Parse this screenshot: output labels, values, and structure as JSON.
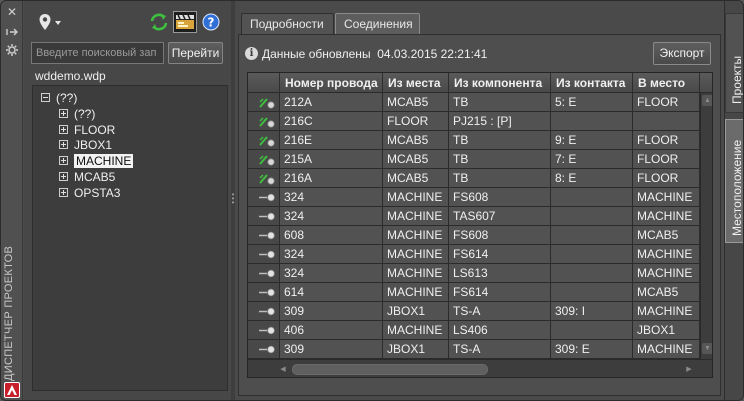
{
  "strip": {
    "title": "ДИСПЕТЧЕР ПРОЕКТОВ",
    "icons": [
      "close-icon",
      "pin-icon",
      "settings-icon"
    ],
    "logo": "autocad-electrical-logo"
  },
  "toolbar": {
    "icons": [
      "location-pin-icon",
      "dropdown-arrow-icon",
      "refresh-icon",
      "clapperboard-icon",
      "help-icon"
    ]
  },
  "search": {
    "placeholder": "Введите поисковый зап",
    "go_label": "Перейти"
  },
  "project": {
    "name": "wddemo.wdp"
  },
  "tree": {
    "root": "(??)",
    "children": [
      {
        "label": "(??)",
        "expanded": false
      },
      {
        "label": "FLOOR",
        "expanded": false
      },
      {
        "label": "JBOX1",
        "expanded": false
      },
      {
        "label": "MACHINE",
        "expanded": false,
        "selected": true
      },
      {
        "label": "MCAB5",
        "expanded": false
      },
      {
        "label": "OPSTA3",
        "expanded": false
      }
    ]
  },
  "tabs": [
    {
      "label": "Подробности",
      "active": false
    },
    {
      "label": "Соединения",
      "active": true
    }
  ],
  "info": {
    "text": "Данные обновлены",
    "datetime": "04.03.2015 22:21:41"
  },
  "export_label": "Экспорт",
  "grid": {
    "columns": [
      "",
      "Номер провода",
      "Из места",
      "Из компонента",
      "Из контакта",
      "В место"
    ],
    "rows": [
      {
        "type": "wire",
        "cells": [
          "212A",
          "MCAB5",
          "TB",
          "5: E",
          "FLOOR"
        ]
      },
      {
        "type": "wire",
        "cells": [
          "216C",
          "FLOOR",
          "PJ215 : [P]",
          "",
          ""
        ]
      },
      {
        "type": "wire",
        "cells": [
          "216E",
          "MCAB5",
          "TB",
          "9: E",
          "FLOOR"
        ]
      },
      {
        "type": "wire",
        "cells": [
          "215A",
          "MCAB5",
          "TB",
          "7: E",
          "FLOOR"
        ]
      },
      {
        "type": "wire",
        "cells": [
          "216A",
          "MCAB5",
          "TB",
          "8: E",
          "FLOOR"
        ]
      },
      {
        "type": "cable",
        "cells": [
          "324",
          "MACHINE",
          "FS608",
          "",
          "MACHINE"
        ]
      },
      {
        "type": "cable",
        "cells": [
          "324",
          "MACHINE",
          "TAS607",
          "",
          "MACHINE"
        ]
      },
      {
        "type": "cable",
        "cells": [
          "608",
          "MACHINE",
          "FS608",
          "",
          "MCAB5"
        ]
      },
      {
        "type": "cable",
        "cells": [
          "324",
          "MACHINE",
          "FS614",
          "",
          "MACHINE"
        ]
      },
      {
        "type": "cable",
        "cells": [
          "324",
          "MACHINE",
          "LS613",
          "",
          "MACHINE"
        ]
      },
      {
        "type": "cable",
        "cells": [
          "614",
          "MACHINE",
          "FS614",
          "",
          "MCAB5"
        ]
      },
      {
        "type": "cable",
        "cells": [
          "309",
          "JBOX1",
          "TS-A",
          "309: I",
          "MACHINE"
        ]
      },
      {
        "type": "cable",
        "cells": [
          "406",
          "MACHINE",
          "LS406",
          "",
          "JBOX1"
        ]
      },
      {
        "type": "cable",
        "cells": [
          "309",
          "JBOX1",
          "TS-A",
          "309: E",
          "MACHINE"
        ]
      }
    ]
  },
  "side_tabs": [
    {
      "label": "Проекты",
      "active": false
    },
    {
      "label": "Местоположение",
      "active": true
    }
  ],
  "colors": {
    "accent_green": "#3fbf3f",
    "logo_red": "#c8202a"
  }
}
